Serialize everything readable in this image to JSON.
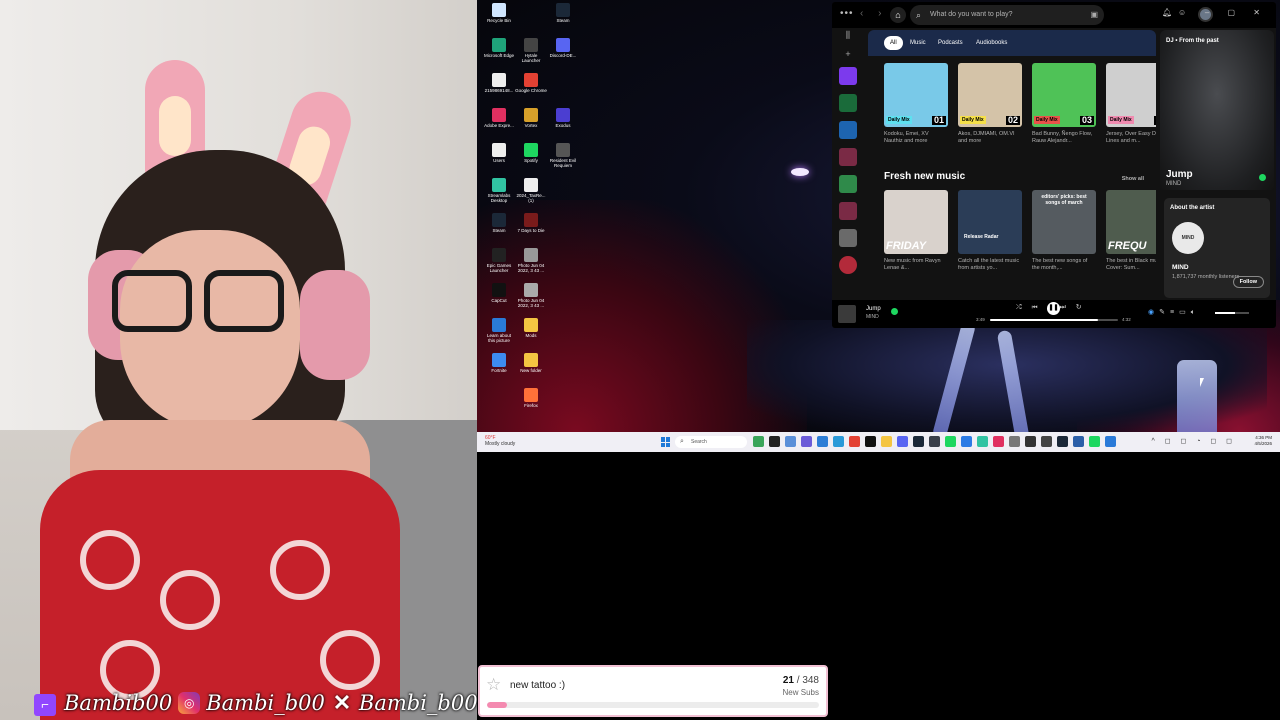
{
  "webcam": {
    "socials": {
      "twitch": "Bambib00",
      "instagram": "Bambi_b00",
      "x": "Bambi_b00"
    }
  },
  "desktop": {
    "icons": [
      {
        "label": "Recycle Bin",
        "icon": "recycle-bin-icon",
        "color": "#d0e6ff"
      },
      {
        "label": "Steam",
        "icon": "steam-icon",
        "color": "#1b2838"
      },
      {
        "label": "Microsoft Edge",
        "icon": "edge-icon",
        "color": "#1fa37a"
      },
      {
        "label": "Hytale Launcher",
        "icon": "hytale-icon",
        "color": "#444"
      },
      {
        "label": "Discord-DE...",
        "icon": "discord-icon",
        "color": "#5865f2"
      },
      {
        "label": "2159869148...",
        "icon": "file-icon",
        "color": "#eee"
      },
      {
        "label": "Google Chrome",
        "icon": "chrome-icon",
        "color": "#e34133"
      },
      {
        "label": "Adobe Expre...",
        "icon": "adobe-icon",
        "color": "#e03060"
      },
      {
        "label": "Vortex",
        "icon": "vortex-icon",
        "color": "#d7a02a"
      },
      {
        "label": "Exodus",
        "icon": "exodus-icon",
        "color": "#4b3ed1"
      },
      {
        "label": "Users",
        "icon": "file-icon",
        "color": "#eee"
      },
      {
        "label": "Spotify",
        "icon": "spotify-icon",
        "color": "#1ed760"
      },
      {
        "label": "Resident Evil Requiem",
        "icon": "game-icon",
        "color": "#555"
      },
      {
        "label": "Streamlabs Desktop",
        "icon": "streamlabs-icon",
        "color": "#31c3a2"
      },
      {
        "label": "2024_TaxRe... (1)",
        "icon": "pdf-icon",
        "color": "#eee"
      },
      {
        "label": "Steam",
        "icon": "steam-icon",
        "color": "#1b2838"
      },
      {
        "label": "7 Days to Die",
        "icon": "game-icon",
        "color": "#7a1b1b"
      },
      {
        "label": "Epic Games Launcher",
        "icon": "epic-icon",
        "color": "#222"
      },
      {
        "label": "Photo Jun 04 2022, 3 43 ...",
        "icon": "photo-icon",
        "color": "#999"
      },
      {
        "label": "CapCut",
        "icon": "capcut-icon",
        "color": "#111"
      },
      {
        "label": "Photo Jun 04 2022, 3 43 ...",
        "icon": "photo-icon",
        "color": "#aaa"
      },
      {
        "label": "Learn about this picture",
        "icon": "picture-info-icon",
        "color": "#2a7ad8"
      },
      {
        "label": "Mods",
        "icon": "folder-icon",
        "color": "#f4c542"
      },
      {
        "label": "Fortnite",
        "icon": "fortnite-icon",
        "color": "#3d8bf0"
      },
      {
        "label": "New folder",
        "icon": "folder-icon",
        "color": "#f4c542"
      },
      {
        "label": "Firefox",
        "icon": "firefox-icon",
        "color": "#ff7139"
      }
    ]
  },
  "taskbar": {
    "weather_temp": "60°F",
    "weather_desc": "Mostly cloudy",
    "search_placeholder": "Search",
    "time": "4:36 PM",
    "date": "4/5/2026"
  },
  "spotify": {
    "search_placeholder": "What do you want to play?",
    "filters": [
      "All",
      "Music",
      "Podcasts",
      "Audiobooks"
    ],
    "mixes": [
      {
        "badge": "Daily Mix",
        "num": "01",
        "artists": "Kodoku, Emei, XV Nauthiz and more",
        "color": "#79c9e8",
        "badge_color": "#5ee0f0"
      },
      {
        "badge": "Daily Mix",
        "num": "02",
        "artists": "Akos, DJMIAMI, OM.VI and more",
        "color": "#d4c3a8",
        "badge_color": "#f5e04a"
      },
      {
        "badge": "Daily Mix",
        "num": "03",
        "artists": "Bad Bunny, Ñengo Flow, Rauw Alejandr...",
        "color": "#4fc257",
        "badge_color": "#e8534a"
      },
      {
        "badge": "Daily Mix",
        "num": "04",
        "artists": "Jersey, Over Easy Disco Lines and m...",
        "color": "#cfcfcf",
        "badge_color": "#f08bb0"
      }
    ],
    "fresh_title": "Fresh new music",
    "show_all": "Show all",
    "fresh": [
      {
        "overlay": "FRIDAY",
        "desc": "New music from Ravyn Lenae &...",
        "color": "#d9d2cc"
      },
      {
        "overlay": "Release Radar",
        "desc": "Catch all the latest music from artists yo...",
        "color": "#2b3d57"
      },
      {
        "overlay": "editors' picks: best songs of march",
        "desc": "The best new songs of the month,...",
        "color": "#555b60"
      },
      {
        "overlay": "FREQU",
        "desc": "The best in Black music! Cover: Sum...",
        "color": "#4f5c4e"
      }
    ],
    "side": {
      "header": "DJ • From the past",
      "song": "Jump",
      "artist": "MIND",
      "about": "About the artist",
      "logo": "MIND",
      "artist_name": "MIND",
      "listeners": "1,871,737 monthly listeners",
      "follow": "Follow"
    },
    "player": {
      "title": "Jump",
      "artist": "MIND",
      "elapsed": "3:49",
      "duration": "4:32",
      "progress": 0.84,
      "volume": 0.6
    }
  },
  "subgoal": {
    "name": "new tattoo :)",
    "current": "21",
    "target": "348",
    "unit": "New Subs",
    "progress": 0.06
  }
}
